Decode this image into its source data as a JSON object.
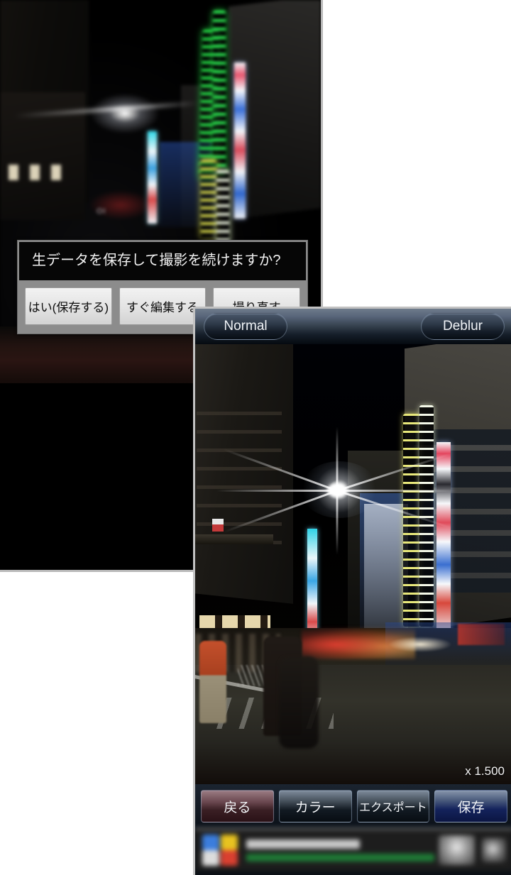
{
  "page": {
    "background_color": "#ffffff"
  },
  "window_camera": {
    "name": "camera-preview-window",
    "dialog": {
      "title": "生データを保存して撮影を続けますか?",
      "buttons": [
        {
          "label": "はい(保存する)",
          "name": "save-raw-button"
        },
        {
          "label": "すぐ編集する",
          "name": "edit-now-button"
        },
        {
          "label": "撮り直す",
          "name": "retake-button"
        }
      ]
    },
    "photo_alt": "blurry night city street with neon signs"
  },
  "window_viewer": {
    "name": "deblur-result-window",
    "header": {
      "left_toggle": "Normal",
      "right_toggle": "Deblur"
    },
    "photo_alt": "deblurred night city street with starburst streetlight, neon towers, pedestrians and cyclist",
    "zoom_label": "x 1.500",
    "toolbar": [
      {
        "label": "戻る",
        "name": "back-button",
        "color": "#6b4850"
      },
      {
        "label": "カラー",
        "name": "color-button",
        "color": "#49545f"
      },
      {
        "label": "エクスポート",
        "name": "export-button",
        "color": "#49545f"
      },
      {
        "label": "保存",
        "name": "save-button",
        "color": "#14235c"
      }
    ],
    "ad_bar": {
      "logo_colors": [
        "#3b7ddd",
        "#e8c320",
        "#dcdcdc",
        "#d94030"
      ],
      "title_text": "",
      "url_text": ""
    }
  }
}
